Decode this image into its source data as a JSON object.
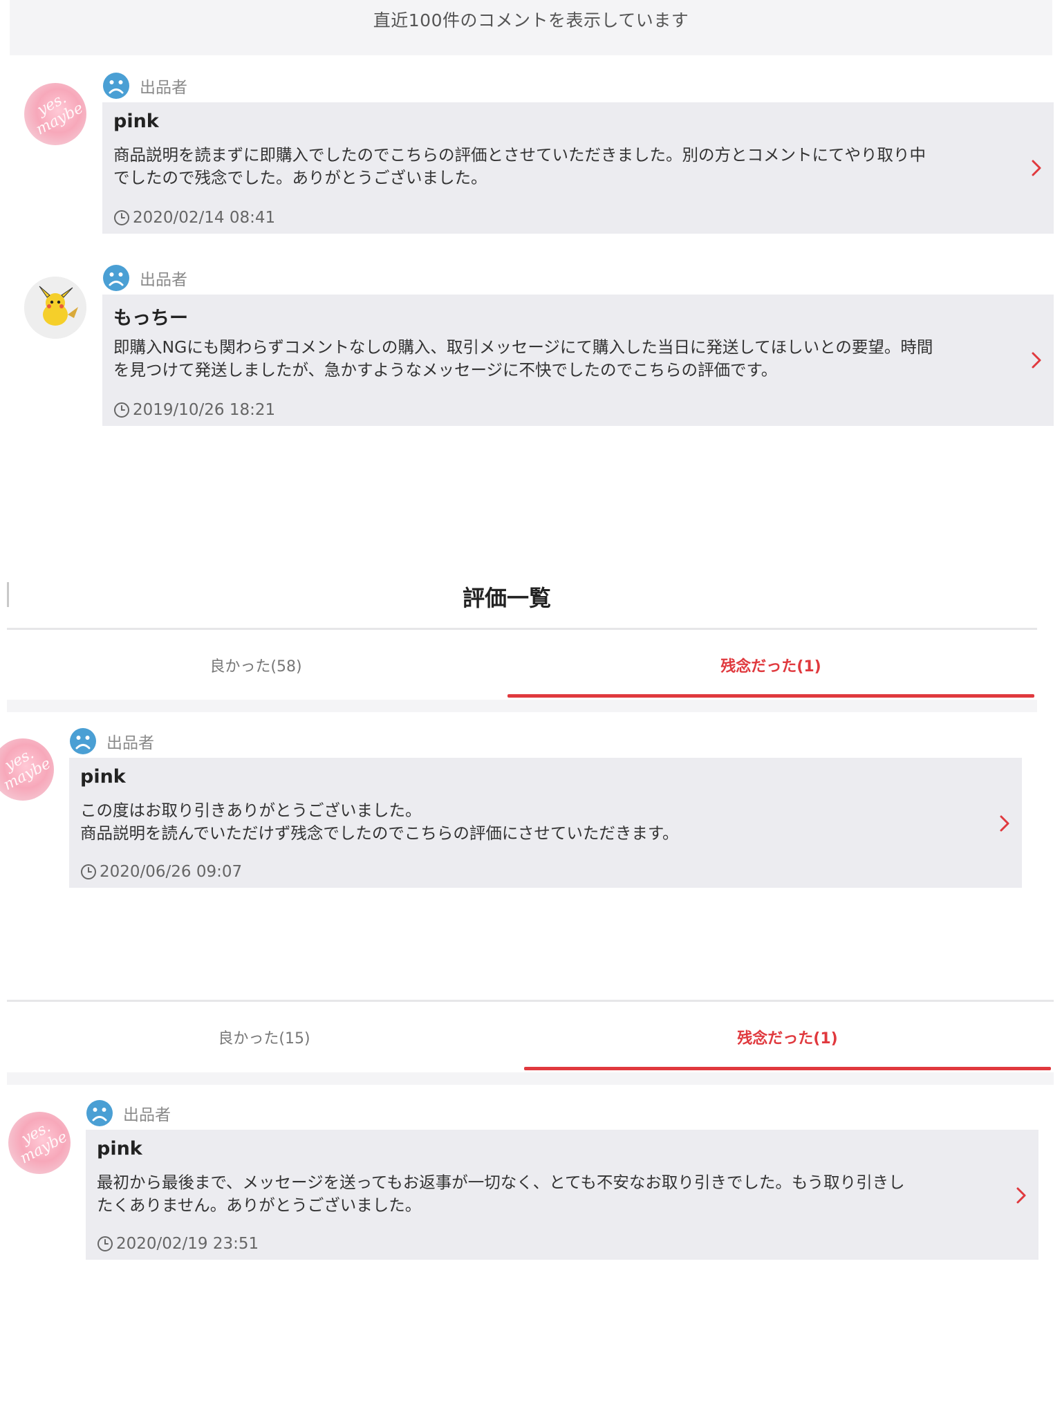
{
  "banner": {
    "text": "直近100件のコメントを表示しています"
  },
  "panel1": {
    "reviews": [
      {
        "role": "出品者",
        "name": "pink",
        "comment": "商品説明を読まずに即購入でしたのでこちらの評価とさせていただきました。別の方とコメントにてやり取り中\nでしたので残念でした。ありがとうございました。",
        "date": "2020/02/14 08:41",
        "avatar": "pink-script-avatar",
        "avatar_text": "yes. maybe"
      },
      {
        "role": "出品者",
        "name": "もっちー",
        "comment": "即購入NGにも関わらずコメントなしの購入、取引メッセージにて購入した当日に発送してほしいとの要望。時間\nを見つけて発送しましたが、急かすようなメッセージに不快でしたのでこちらの評価です。",
        "date": "2019/10/26 18:21",
        "avatar": "pikachu-avatar"
      }
    ]
  },
  "panel2": {
    "title": "評価一覧",
    "tabs": {
      "good": "良かった(58)",
      "bad": "残念だった(1)",
      "active": "bad"
    },
    "review": {
      "role": "出品者",
      "name": "pink",
      "comment": "この度はお取り引きありがとうございました。\n商品説明を読んでいただけず残念でしたのでこちらの評価にさせていただきます。",
      "date": "2020/06/26 09:07",
      "avatar": "pink-script-avatar",
      "avatar_text": "yes. maybe"
    }
  },
  "panel3": {
    "tabs": {
      "good": "良かった(15)",
      "bad": "残念だった(1)",
      "active": "bad"
    },
    "review": {
      "role": "出品者",
      "name": "pink",
      "comment": "最初から最後まで、メッセージを送ってもお返事が一切なく、とても不安なお取り引きでした。もう取り引きし\nたくありません。ありがとうございました。",
      "date": "2020/02/19 23:51",
      "avatar": "pink-script-avatar",
      "avatar_text": "yes. maybe"
    }
  },
  "colors": {
    "accent": "#e0393e",
    "sad_icon": "#4a9fd4",
    "bubble": "#ececf0",
    "strip": "#f4f4f6"
  },
  "icons": {
    "role": "sad-face-icon",
    "date": "clock-icon",
    "row": "chevron-right-icon"
  }
}
